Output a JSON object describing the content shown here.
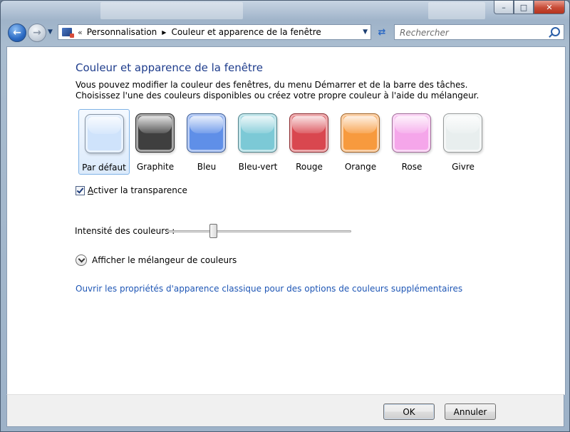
{
  "nav": {
    "breadcrumb_sep": "«",
    "crumbs": [
      "Personnalisation",
      "Couleur et apparence de la fenêtre"
    ],
    "search_placeholder": "Rechercher"
  },
  "main": {
    "title": "Couleur et apparence de la fenêtre",
    "description": "Vous pouvez modifier la couleur des fenêtres, du menu Démarrer et de la barre des tâches. Choisissez l'une des couleurs disponibles ou créez votre propre couleur à l'aide du mélangeur.",
    "swatches": [
      {
        "label": "Par défaut",
        "color": "#cfe3fb",
        "selected": true
      },
      {
        "label": "Graphite",
        "color": "#3f3f3f",
        "selected": false
      },
      {
        "label": "Bleu",
        "color": "#5f8fe8",
        "selected": false
      },
      {
        "label": "Bleu-vert",
        "color": "#7cc9d6",
        "selected": false
      },
      {
        "label": "Rouge",
        "color": "#d9474f",
        "selected": false
      },
      {
        "label": "Orange",
        "color": "#f79a3e",
        "selected": false
      },
      {
        "label": "Rose",
        "color": "#f5a6ea",
        "selected": false
      },
      {
        "label": "Givre",
        "color": "#e8eeee",
        "selected": false
      }
    ],
    "transparency": {
      "accel": "A",
      "rest": "ctiver la transparence",
      "checked": true
    },
    "intensity": {
      "label": "Intensité des couleurs :",
      "value_fraction": 0.24
    },
    "mixer_label": "Afficher le mélangeur de couleurs",
    "classic_link": "Ouvrir les propriétés d'apparence classique pour des options de couleurs supplémentaires"
  },
  "footer": {
    "ok": "OK",
    "cancel": "Annuler"
  },
  "colors": {
    "title": "#1e3c8c",
    "link": "#1e56b5",
    "close_button": "#c74b36"
  }
}
